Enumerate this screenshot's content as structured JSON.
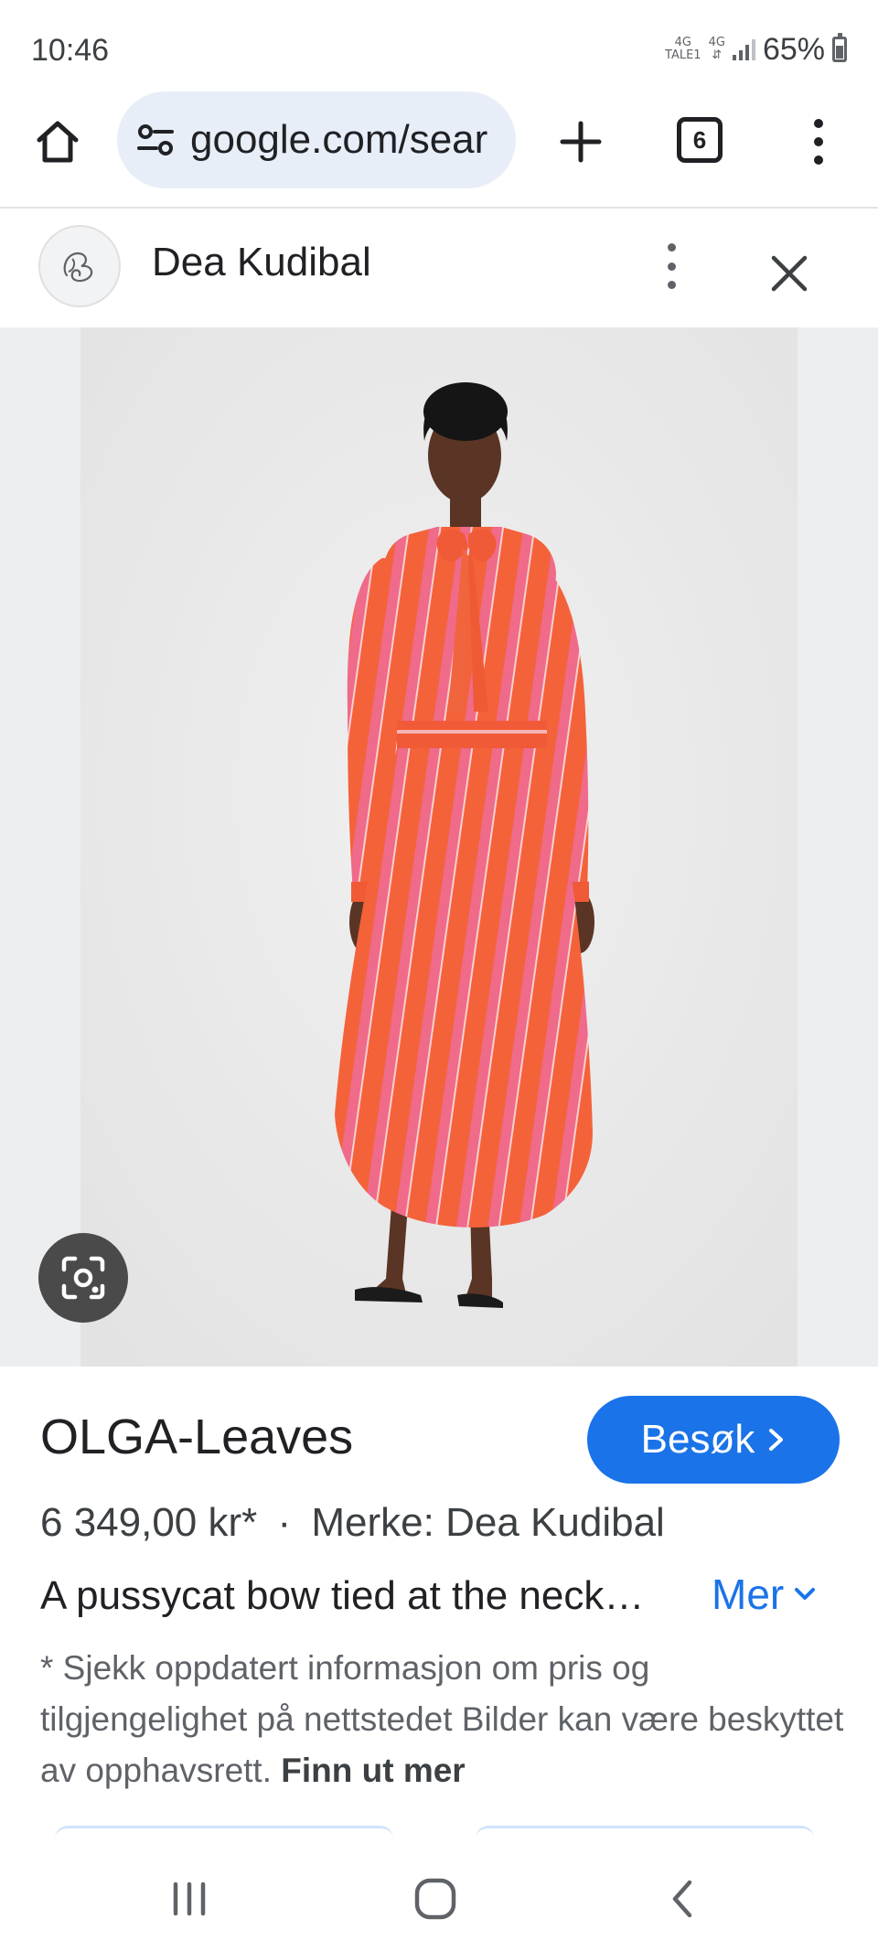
{
  "status_bar": {
    "time": "10:46",
    "network_1_top": "4G",
    "network_1_bottom": "TALE1",
    "network_2": "4G",
    "battery_percent": "65%"
  },
  "browser": {
    "url": "google.com/sear",
    "tab_count": "6",
    "icons": [
      "home-icon",
      "site-info-icon",
      "plus-icon",
      "tab-switcher-icon",
      "more-vert-icon"
    ]
  },
  "source": {
    "name": "Dea Kudibal",
    "icons": [
      "more-vert-icon",
      "close-icon"
    ]
  },
  "product": {
    "title": "OLGA-Leaves",
    "visit_label": "Besøk",
    "price": "6 349,00 kr*",
    "separator": "·",
    "brand": "Merke: Dea Kudibal",
    "description": "A pussycat bow tied at the neck…",
    "more_label": "Mer",
    "disclaimer": "* Sjekk oppdatert informasjon om pris og tilgjengelighet på nettstedet Bilder kan være beskyttet av opphavsrett.",
    "learn_more": "Finn ut mer"
  },
  "colors": {
    "accent": "#1a73e8",
    "url_bar_bg": "#e8eef8",
    "dress_orange": "#f4623a",
    "dress_pink": "#f06a8a"
  }
}
